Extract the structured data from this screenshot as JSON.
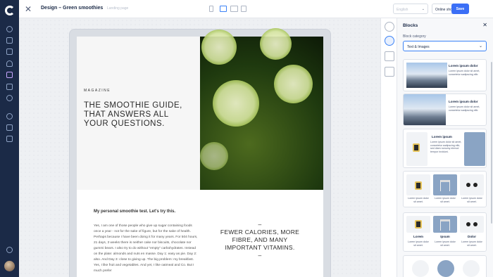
{
  "app": {
    "title": "Design – Green smoothies",
    "subtitle": "Landing page",
    "close_label": "✕"
  },
  "top": {
    "language": "English",
    "store": "Online shop",
    "save_label": "Save"
  },
  "page": {
    "eyebrow": "MAGAZINE",
    "headline": "THE SMOOTHIE GUIDE, THAT ANSWERS ALL YOUR QUESTIONS.",
    "intro": "My personal smoothie test. Let's try this.",
    "body": "Yes, I am one of those people who give up sugar containing foods once a year - not for the sake of figure, but for the sake of health. Perhaps because I have been doing it for many years. For 504 hours, 21 days, 3 weeks there is neither cake nor biscuits, chocolate nor gummi bears. I also try to do without \"empty\" carbohydrates. Instead on the plate: almonds and nuts en masse. Day 1: easy as pie. Day 2: also. And Day 3: close to giving up. The big problem: my breakfast. Yes, I like fruit and vegetables. And yet, I like oatmeal and Co. But I much prefer",
    "quote_dash_top": "–",
    "quote": "FEWER CALORIES, MORE FIBRE, AND MANY IMPORTANT VITAMINS.",
    "quote_dash_bottom": "–"
  },
  "panel": {
    "title": "Blocks",
    "close_label": "✕",
    "category_label": "Block category",
    "category_value": "Text & Images",
    "cards": [
      {
        "title": "Lorem ipsum dolor",
        "desc": "Lorem ipsum dolor sit amet, consetetur sadipscing elitr."
      },
      {
        "title": "Lorem ipsum dolor",
        "desc": "Lorem ipsum dolor sit amet, consetetur sadipscing elitr."
      },
      {
        "title": "Lorem ipsum",
        "desc": "Lorem ipsum dolor sit amet, consetetur sadipscing elitr, sed diam nonumy eirmod tempor invidunt."
      },
      {
        "captions": [
          "Lorem ipsum dolor sit amet.",
          "Lorem ipsum dolor sit amet.",
          "Lorem ipsum dolor sit amet."
        ]
      },
      {
        "titles": [
          "Lorem",
          "Ipsum",
          "Dolor"
        ],
        "captions": [
          "Lorem ipsum dolor sit amet.",
          "Lorem ipsum dolor sit amet.",
          "Lorem ipsum dolor sit amet."
        ]
      }
    ]
  },
  "colors": {
    "nav_bg": "#1b2a47",
    "accent": "#3b6ff6"
  }
}
